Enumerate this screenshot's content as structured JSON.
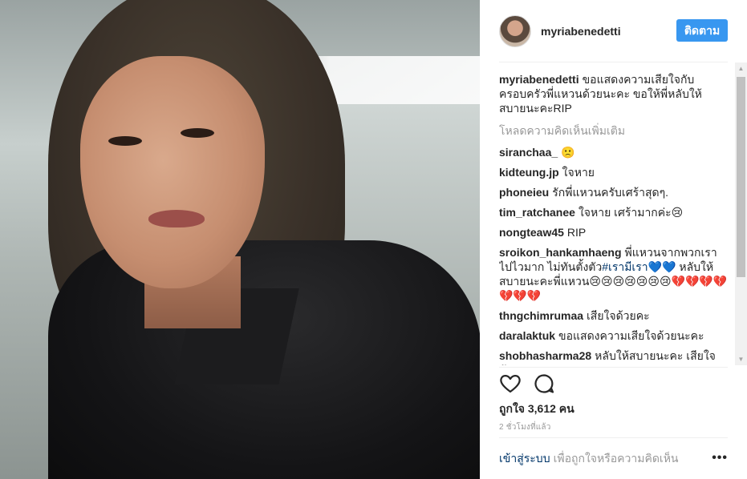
{
  "post": {
    "username": "myriabenedetti",
    "follow_label": "ติดตาม"
  },
  "caption": {
    "username": "myriabenedetti",
    "text": "ขอแสดงความเสียใจกับครอบครัวพี่แหวนด้วยนะคะ ขอให้พี่หลับให้สบายนะคะRIP"
  },
  "load_more": "โหลดความคิดเห็นเพิ่มเติม",
  "comments": [
    {
      "username": "siranchaa_",
      "text": "🙁"
    },
    {
      "username": "kidteung.jp",
      "text": "ใจหาย"
    },
    {
      "username": "phoneieu",
      "text": "รักพี่แหวนครับเศร้าสุดๆ."
    },
    {
      "username": "tim_ratchanee",
      "text": "ใจหาย เศร้ามากค่ะ😢"
    },
    {
      "username": "nongteaw45",
      "text": "RIP"
    },
    {
      "username": "sroikon_hankamhaeng",
      "text_before": "พี่แหวนจากพวกเราไปไวมาก ไม่ทันตั้งตัว",
      "hashtag": "#เรามีเรา",
      "text_after": "💙💙 หลับให้สบายนะคะพี่แหวน😢😢😢😢😢😢😢💔💔💔💔💔💔💔"
    },
    {
      "username": "thngchimrumaa",
      "text": "เสียใจด้วยคะ"
    },
    {
      "username": "daralaktuk",
      "text": "ขอแสดงความเสียใจด้วยนะคะ"
    },
    {
      "username": "shobhasharma28",
      "text": "หลับให้สบายนะคะ เสียใจด้วยคะ"
    }
  ],
  "likes": "ถูกใจ 3,612 คน",
  "timestamp": "2 ชั่วโมงที่แล้ว",
  "login": {
    "link": "เข้าสู่ระบบ",
    "rest": "เพื่อถูกใจหรือความคิดเห็น"
  },
  "icons": {
    "like": "heart-icon",
    "comment": "comment-bubble-icon",
    "more": "more-dots-icon"
  },
  "colors": {
    "accent": "#3897f0",
    "link": "#003569",
    "muted": "#999999"
  }
}
